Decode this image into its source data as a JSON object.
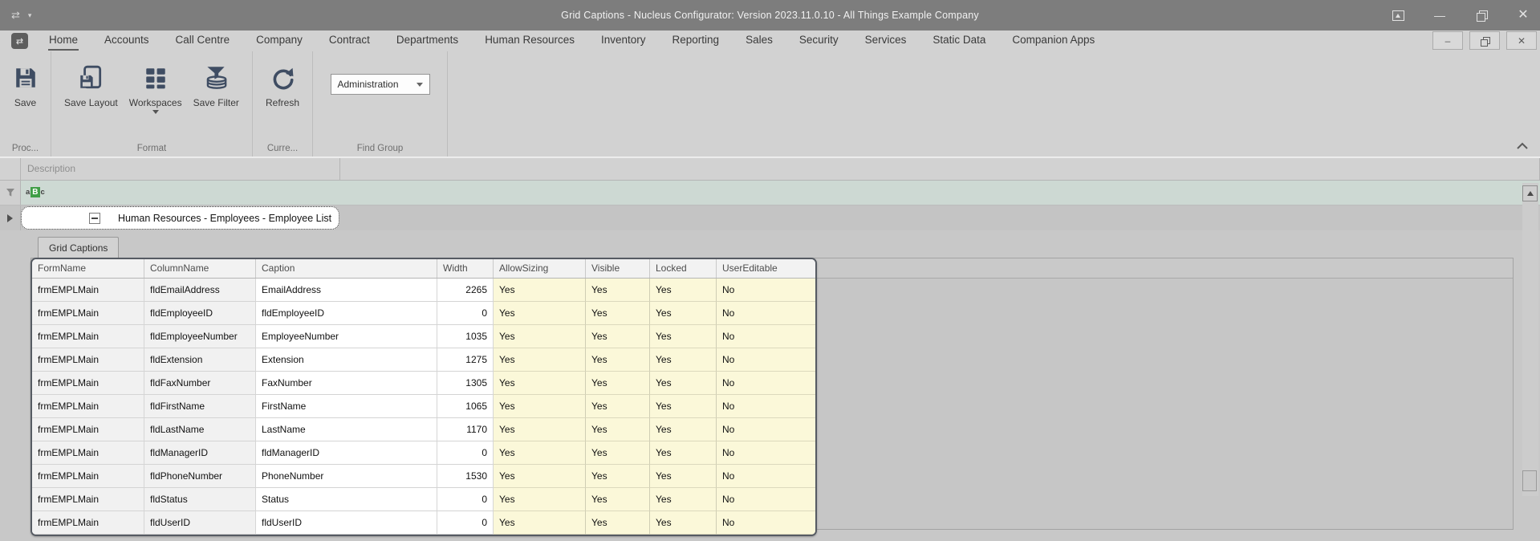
{
  "window": {
    "title": "Grid Captions - Nucleus Configurator: Version 2023.11.0.10 - All Things Example Company"
  },
  "ribbon": {
    "tabs": [
      "Home",
      "Accounts",
      "Call Centre",
      "Company",
      "Contract",
      "Departments",
      "Human Resources",
      "Inventory",
      "Reporting",
      "Sales",
      "Security",
      "Services",
      "Static Data",
      "Companion Apps"
    ],
    "active_tab": "Home",
    "groups": {
      "process": {
        "label": "Proc...",
        "save": "Save"
      },
      "format": {
        "label": "Format",
        "save_layout": "Save Layout",
        "workspaces": "Workspaces",
        "save_filter": "Save Filter"
      },
      "current": {
        "label": "Curre...",
        "refresh": "Refresh"
      },
      "find_group": {
        "label": "Find Group",
        "combo_value": "Administration"
      }
    }
  },
  "tree": {
    "column_header": "Description",
    "filter_abc": {
      "a": "a",
      "b": "B",
      "c": "c"
    },
    "item": "Human Resources - Employees - Employee List"
  },
  "detail": {
    "tab": "Grid Captions",
    "table": {
      "columns": [
        "FormName",
        "ColumnName",
        "Caption",
        "Width",
        "AllowSizing",
        "Visible",
        "Locked",
        "UserEditable"
      ],
      "rows": [
        [
          "frmEMPLMain",
          "fldEmailAddress",
          "EmailAddress",
          "2265",
          "Yes",
          "Yes",
          "Yes",
          "No"
        ],
        [
          "frmEMPLMain",
          "fldEmployeeID",
          "fldEmployeeID",
          "0",
          "Yes",
          "Yes",
          "Yes",
          "No"
        ],
        [
          "frmEMPLMain",
          "fldEmployeeNumber",
          "EmployeeNumber",
          "1035",
          "Yes",
          "Yes",
          "Yes",
          "No"
        ],
        [
          "frmEMPLMain",
          "fldExtension",
          "Extension",
          "1275",
          "Yes",
          "Yes",
          "Yes",
          "No"
        ],
        [
          "frmEMPLMain",
          "fldFaxNumber",
          "FaxNumber",
          "1305",
          "Yes",
          "Yes",
          "Yes",
          "No"
        ],
        [
          "frmEMPLMain",
          "fldFirstName",
          "FirstName",
          "1065",
          "Yes",
          "Yes",
          "Yes",
          "No"
        ],
        [
          "frmEMPLMain",
          "fldLastName",
          "LastName",
          "1170",
          "Yes",
          "Yes",
          "Yes",
          "No"
        ],
        [
          "frmEMPLMain",
          "fldManagerID",
          "fldManagerID",
          "0",
          "Yes",
          "Yes",
          "Yes",
          "No"
        ],
        [
          "frmEMPLMain",
          "fldPhoneNumber",
          "PhoneNumber",
          "1530",
          "Yes",
          "Yes",
          "Yes",
          "No"
        ],
        [
          "frmEMPLMain",
          "fldStatus",
          "Status",
          "0",
          "Yes",
          "Yes",
          "Yes",
          "No"
        ],
        [
          "frmEMPLMain",
          "fldUserID",
          "fldUserID",
          "0",
          "Yes",
          "Yes",
          "Yes",
          "No"
        ]
      ]
    }
  },
  "colors": {
    "icon": "#3f4d63",
    "cell_yellow": "#fbf8d9",
    "filter_row": "#cdd9d3",
    "filter_green": "#3f9e46"
  }
}
